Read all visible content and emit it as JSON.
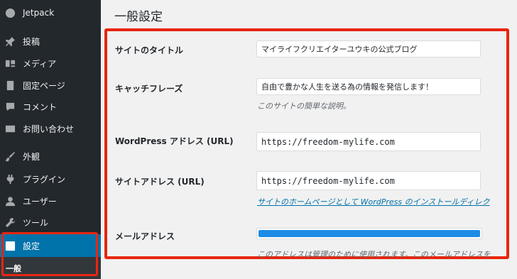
{
  "sidebar": {
    "items": [
      {
        "label": "Jetpack",
        "icon": "jetpack-icon"
      },
      {
        "label": "投稿",
        "icon": "pin-icon"
      },
      {
        "label": "メディア",
        "icon": "media-icon"
      },
      {
        "label": "固定ページ",
        "icon": "page-icon"
      },
      {
        "label": "コメント",
        "icon": "comment-icon"
      },
      {
        "label": "お問い合わせ",
        "icon": "mail-icon"
      },
      {
        "label": "外観",
        "icon": "brush-icon"
      },
      {
        "label": "プラグイン",
        "icon": "plugin-icon"
      },
      {
        "label": "ユーザー",
        "icon": "user-icon"
      },
      {
        "label": "ツール",
        "icon": "wrench-icon"
      },
      {
        "label": "設定",
        "icon": "settings-icon"
      }
    ],
    "submenu_label": "一般",
    "highlight_color": "#e8260f",
    "current_color": "#0073aa"
  },
  "main": {
    "title": "一般設定",
    "site_title_label": "サイトのタイトル",
    "site_title_value": "マイライフクリエイターユウキの公式ブログ",
    "tagline_label": "キャッチフレーズ",
    "tagline_value": "自由で豊かな人生を送る為の情報を発信します！",
    "tagline_desc": "このサイトの簡単な説明。",
    "wp_address_label": "WordPress アドレス (URL)",
    "wp_address_value": "https://freedom-mylife.com",
    "site_address_label": "サイトアドレス (URL)",
    "site_address_value": "https://freedom-mylife.com",
    "site_address_link": "サイトのホームページとして WordPress のインストールディレク",
    "email_label": "メールアドレス",
    "email_desc": "このアドレスは管理のために使用されます。このメールアドレスを",
    "email_fill_color": "#1e8ce5"
  }
}
